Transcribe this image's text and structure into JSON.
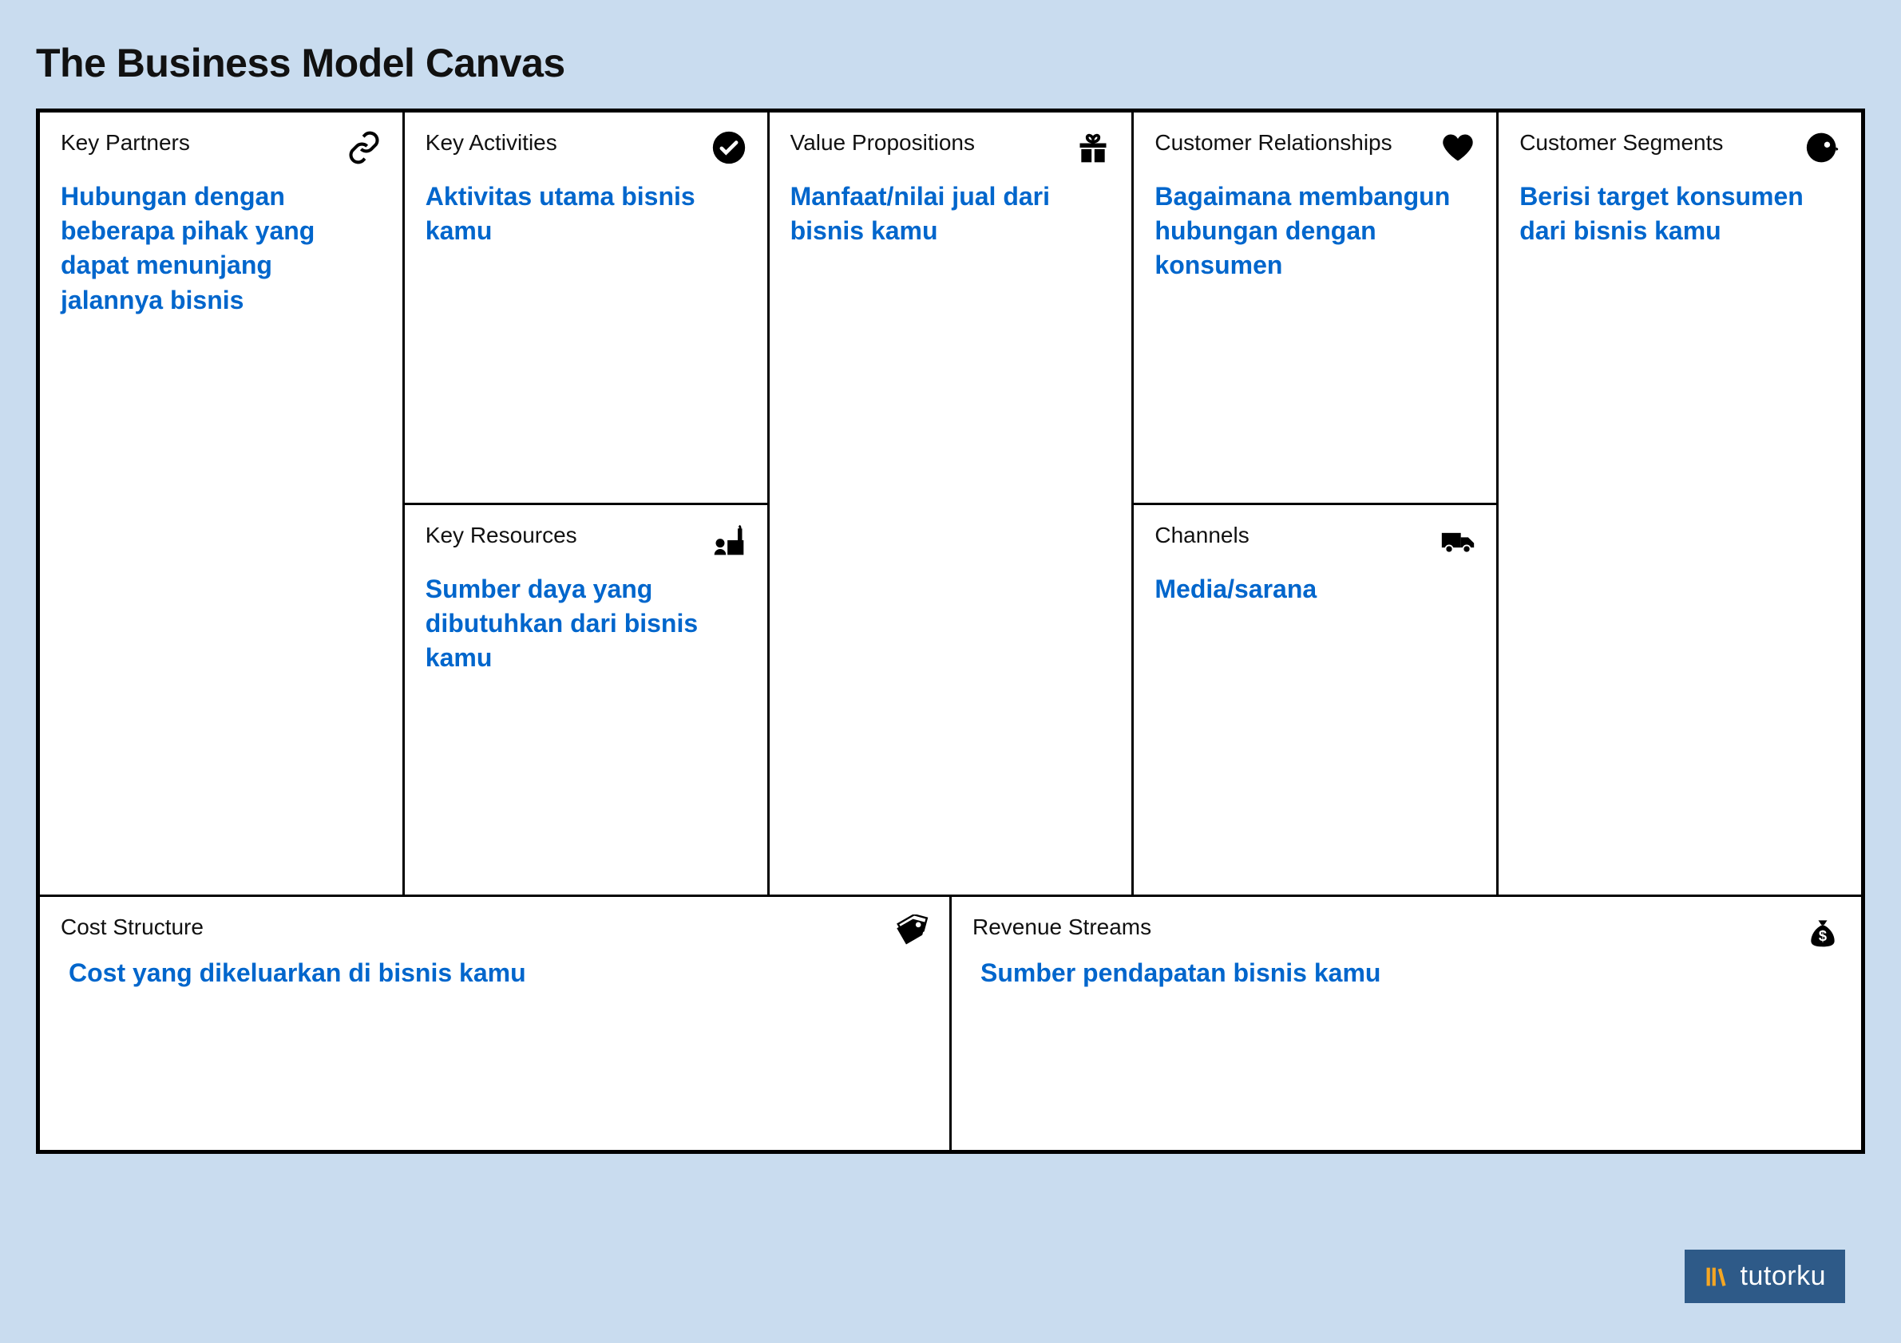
{
  "title": "The Business Model Canvas",
  "cells": {
    "key_partners": {
      "title": "Key Partners",
      "content": "Hubungan dengan beberapa pihak yang dapat menunjang jalannya bisnis"
    },
    "key_activities": {
      "title": "Key Activities",
      "content": "Aktivitas utama bisnis kamu"
    },
    "key_resources": {
      "title": "Key Resources",
      "content": "Sumber daya yang dibutuhkan dari bisnis kamu"
    },
    "value_propositions": {
      "title": "Value Propositions",
      "content": "Manfaat/nilai jual dari bisnis kamu"
    },
    "customer_relationships": {
      "title": "Customer Relationships",
      "content": "Bagaimana membangun hubungan dengan konsumen"
    },
    "channels": {
      "title": "Channels",
      "content": "Media/sarana"
    },
    "customer_segments": {
      "title": "Customer Segments",
      "content": "Berisi target konsumen dari bisnis kamu"
    },
    "cost_structure": {
      "title": "Cost Structure",
      "content": "Cost yang dikeluarkan di bisnis kamu"
    },
    "revenue_streams": {
      "title": "Revenue Streams",
      "content": "Sumber pendapatan bisnis kamu"
    }
  },
  "brand": "tutorku"
}
